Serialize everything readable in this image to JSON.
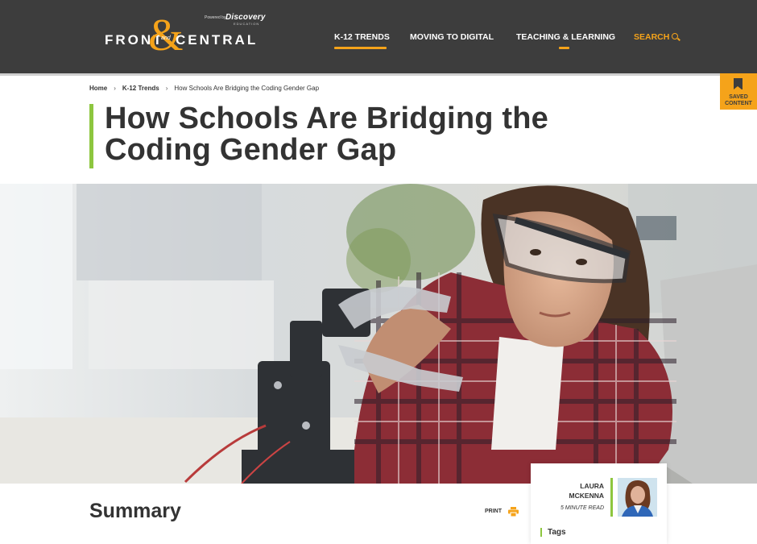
{
  "header": {
    "logo": {
      "front": "FRONT",
      "and": "and",
      "amp": "&",
      "central": "CENTRAL",
      "powered_by": "Powered by",
      "discovery": "Discovery",
      "discovery_sub": "EDUCATION"
    },
    "nav": [
      {
        "label": "K-12 TRENDS",
        "active": true
      },
      {
        "label": "MOVING TO DIGITAL",
        "active": false
      },
      {
        "label": "TEACHING & LEARNING",
        "active": false
      },
      {
        "label": "SEARCH",
        "active": false
      }
    ],
    "accent_color": "#f5a31a",
    "background_color": "#3d3d3d"
  },
  "saved_content": {
    "label_line1": "SAVED",
    "label_line2": "CONTENT",
    "icon": "bookmark-icon"
  },
  "breadcrumb": [
    {
      "label": "Home",
      "link": true
    },
    {
      "label": "K-12 Trends",
      "link": true
    },
    {
      "label": "How Schools Are Bridging the Coding Gender Gap",
      "link": false
    }
  ],
  "article": {
    "title_line1": "How Schools Are Bridging the",
    "title_line2": "Coding Gender Gap",
    "title_accent_color": "#8dc63f",
    "summary_heading": "Summary",
    "print_label": "PRINT"
  },
  "author": {
    "first_name": "LAURA",
    "last_name": "MCKENNA",
    "read_time": "5 MINUTE READ"
  },
  "tags_label": "Tags"
}
